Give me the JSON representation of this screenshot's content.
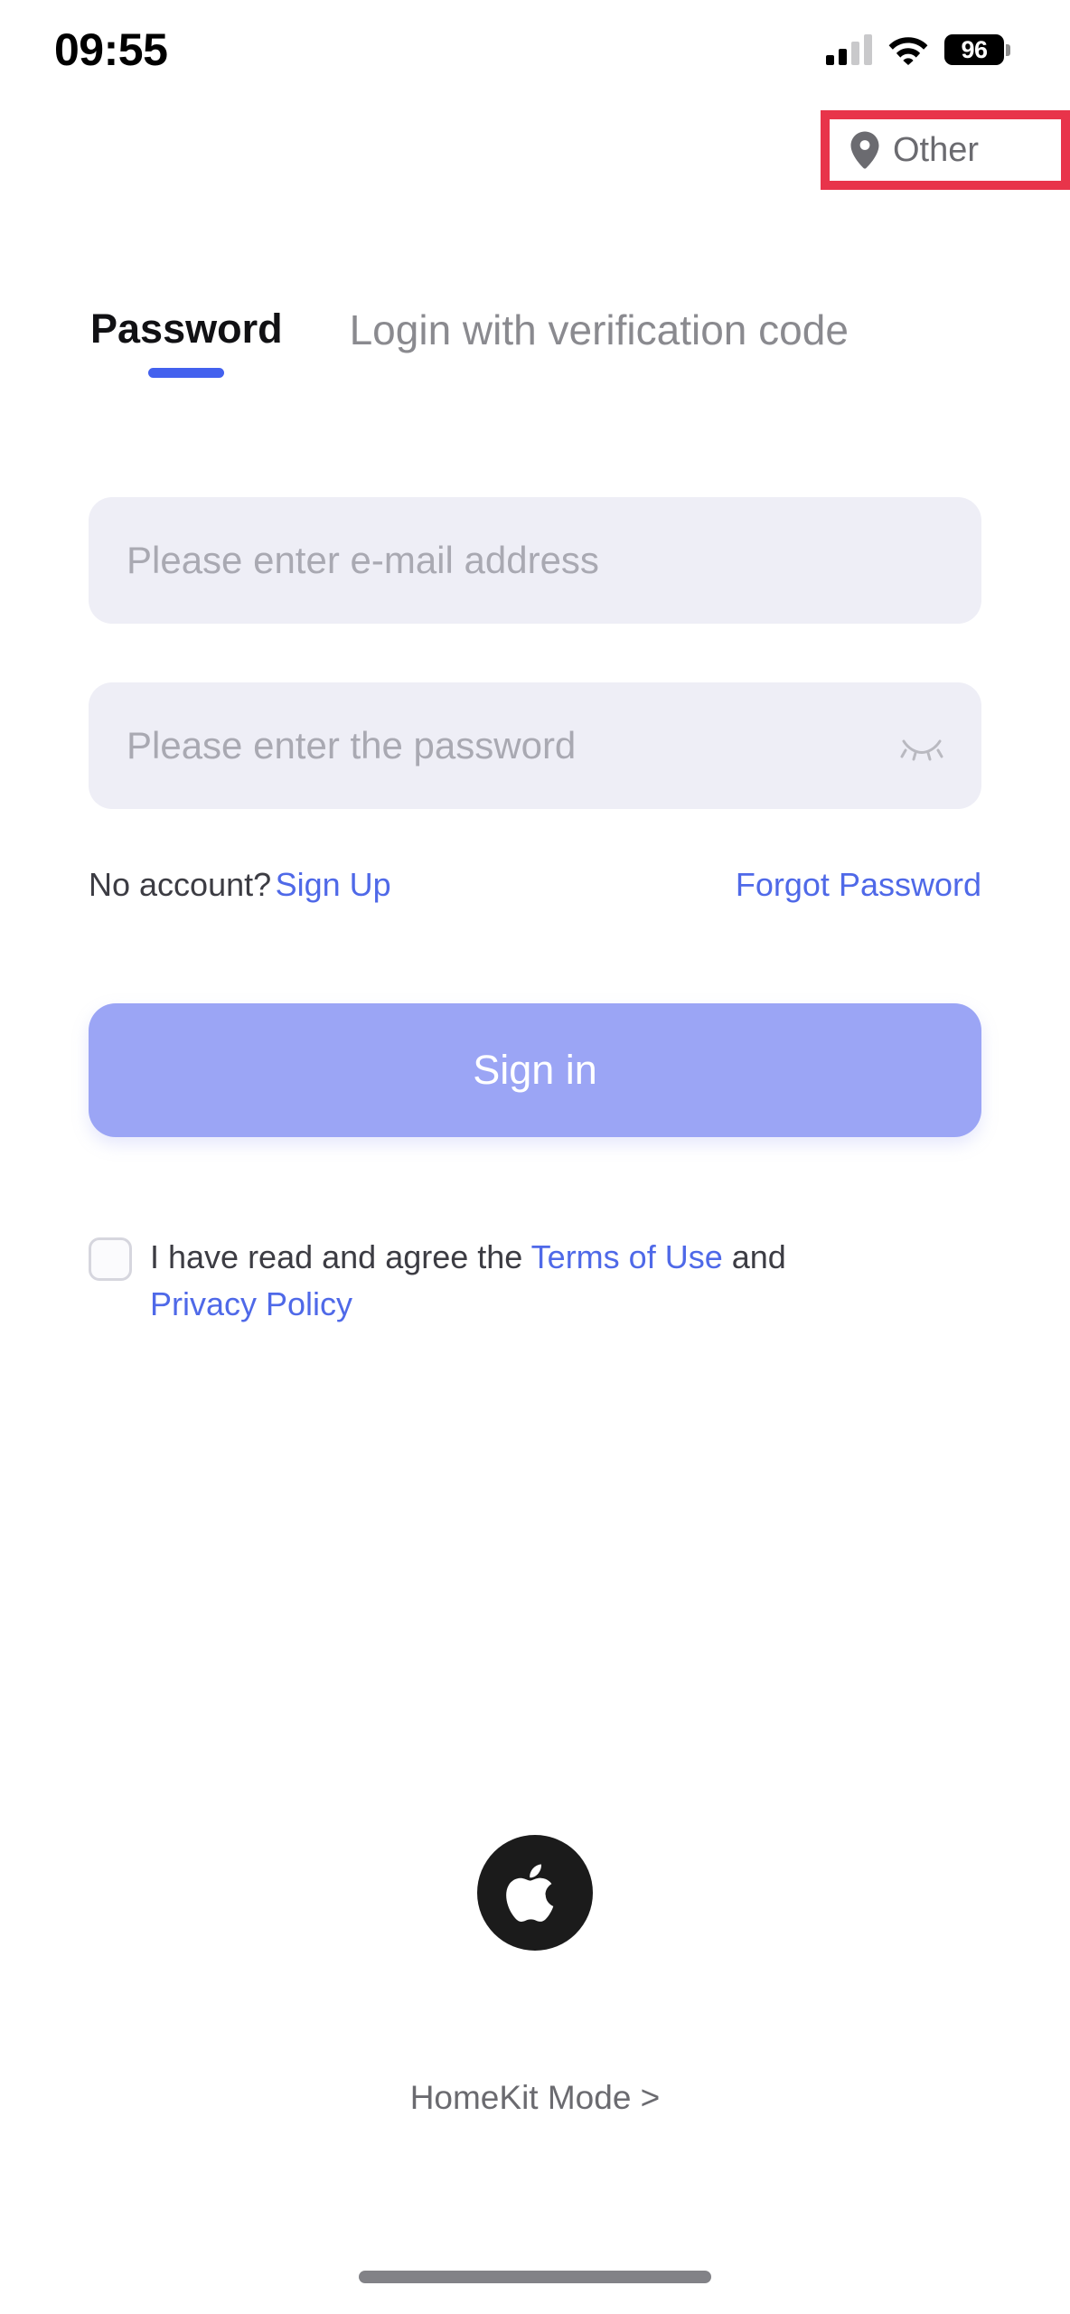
{
  "status_bar": {
    "time": "09:55",
    "battery_level": "96",
    "signal_icon": "cellular-signal-icon",
    "wifi_icon": "wifi-icon",
    "battery_icon": "battery-icon"
  },
  "location": {
    "label": "Other",
    "icon": "map-pin-icon",
    "highlight_color": "#e8344a"
  },
  "tabs": [
    {
      "label": "Password",
      "active": true
    },
    {
      "label": "Login with verification code",
      "active": false
    }
  ],
  "form": {
    "email": {
      "value": "",
      "placeholder": "Please enter e-mail address"
    },
    "password": {
      "value": "",
      "placeholder": "Please enter the password",
      "toggle_icon": "eye-closed-icon"
    },
    "no_account_text": "No account?",
    "sign_up_link": "Sign Up",
    "forgot_password_link": "Forgot Password",
    "submit_label": "Sign in"
  },
  "agreement": {
    "checked": false,
    "prefix": "I have read and agree the",
    "terms_link": "Terms of Use",
    "conjunction": "and",
    "privacy_link": "Privacy Policy"
  },
  "footer": {
    "brand_icon": "apple-logo-icon",
    "homekit_label": "HomeKit Mode >"
  },
  "colors": {
    "accent_blue": "#4361ee",
    "link_blue": "#4f69e8",
    "button_lavender": "#9ba5f5",
    "field_background": "#eeeef6",
    "highlight_red": "#e8344a"
  }
}
